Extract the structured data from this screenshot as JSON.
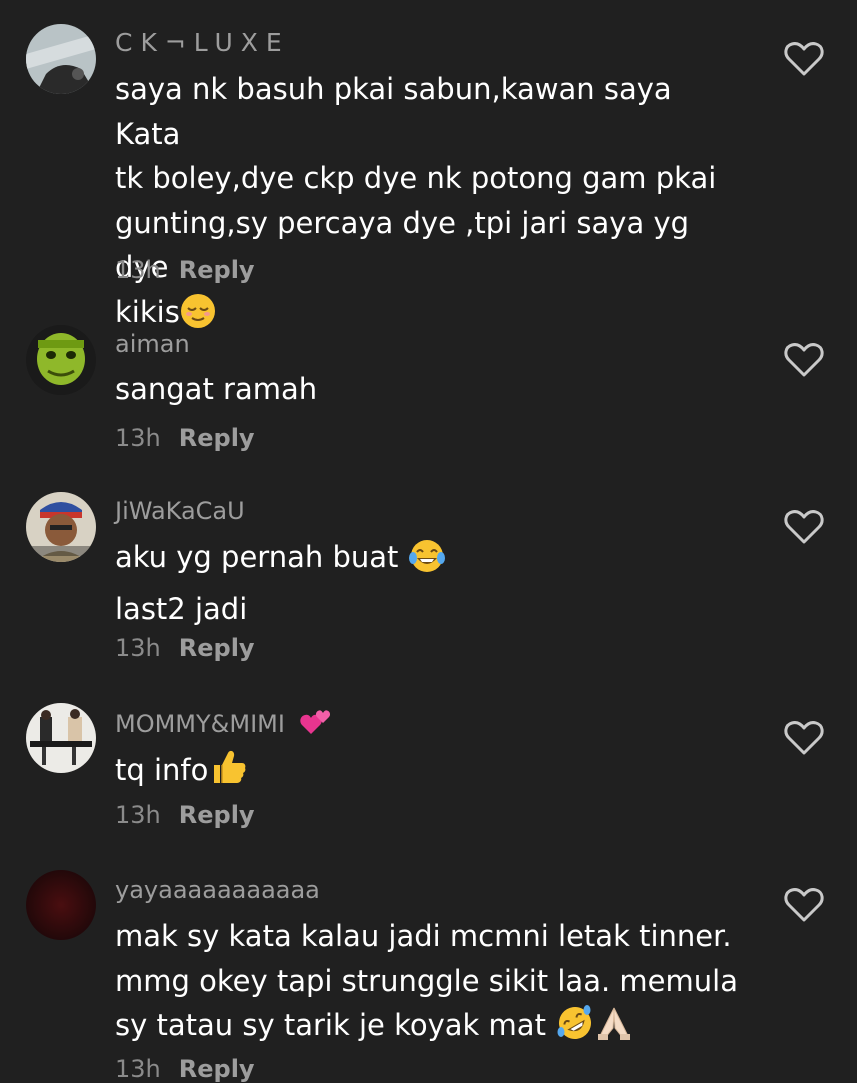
{
  "comments": [
    {
      "username": "CK¬LUXE",
      "lines": [
        "saya nk basuh pkai sabun,kawan saya Kata",
        "tk boley,dye ckp dye nk potong gam pkai",
        "gunting,sy percaya dye ,tpi jari saya yg dye",
        "kikis"
      ],
      "emoji": [
        "relieved-face"
      ],
      "time": "13h",
      "reply": "Reply"
    },
    {
      "username": "aiman",
      "lines": [
        "sangat ramah"
      ],
      "emoji": [],
      "time": "13h",
      "reply": "Reply"
    },
    {
      "username": "JiWaKaCaU",
      "lines": [
        "aku yg pernah buat",
        "last2 jadi"
      ],
      "emoji": [
        "tears-of-joy-face"
      ],
      "time": "13h",
      "reply": "Reply"
    },
    {
      "username": "MOMMY&MIMI",
      "username_emoji": "two-hearts",
      "lines": [
        "tq info"
      ],
      "emoji": [
        "thumbs-up"
      ],
      "time": "13h",
      "reply": "Reply"
    },
    {
      "username": "yayaaaaaaaaaaa",
      "lines": [
        "mak sy kata kalau jadi mcmni letak tinner.",
        "mmg okey tapi strunggle sikit laa. memula",
        "sy tatau sy tarik je koyak mat"
      ],
      "emoji": [
        "rolling-laughing-face",
        "folded-hands"
      ],
      "time": "13h",
      "reply": "Reply"
    }
  ],
  "colors": {
    "background": "#202020",
    "username": "#9d9d9d",
    "text": "#ffffff",
    "meta": "#8b8b8b",
    "emoji_yellow": "#f8c330"
  }
}
